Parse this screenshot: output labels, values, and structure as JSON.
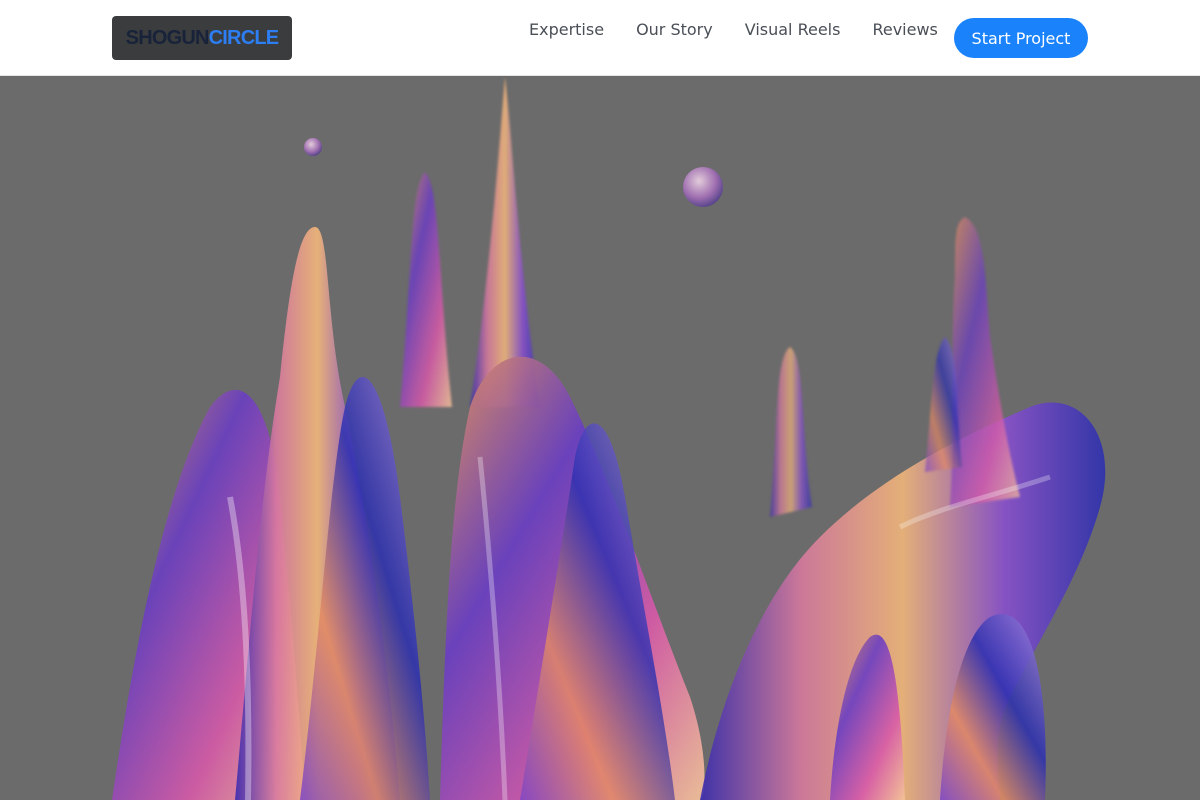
{
  "brand": {
    "logo_part1": "SHOGUN",
    "logo_part2": "CIRCLE",
    "primary_color": "#1a82fb",
    "logo_dark": "#18233a",
    "logo_blue": "#2c7ef2"
  },
  "nav": {
    "items": [
      {
        "label": "Expertise"
      },
      {
        "label": "Our Story"
      },
      {
        "label": "Visual Reels"
      },
      {
        "label": "Reviews"
      }
    ],
    "cta_label": "Start Project"
  },
  "hero": {
    "image": "iridescent-liquid-splash-image",
    "palette": [
      "#6b6b6b",
      "#e7925a",
      "#6a3ec2",
      "#2b2fb0",
      "#d75aa8",
      "#f4b87a"
    ]
  }
}
